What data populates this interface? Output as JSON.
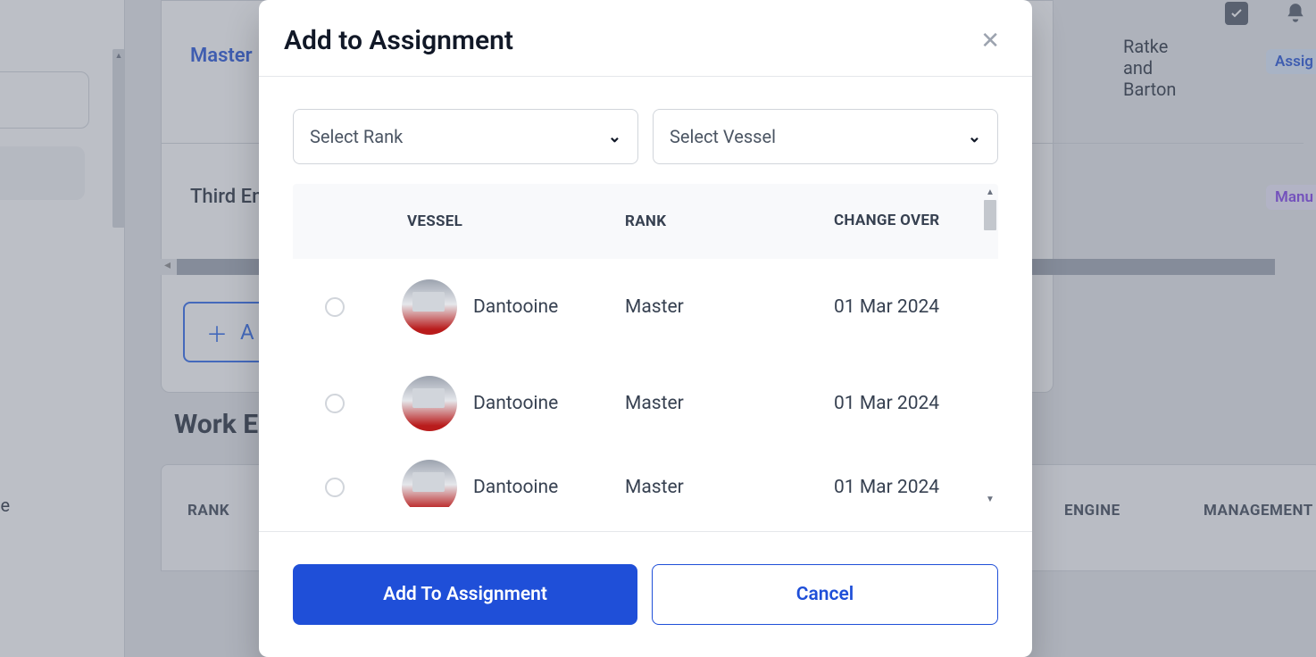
{
  "background": {
    "master_link": "Master",
    "third_en": "Third En",
    "add_btn": "A",
    "work_heading": "Work E",
    "left_text_ce": "ce",
    "ratke_text": "Ratke and Barton",
    "badge_assig": "Assig",
    "badge_manu": "Manu",
    "table": {
      "rank": "RANK",
      "engine": "ENGINE",
      "management": "MANAGEMENT"
    }
  },
  "modal": {
    "title": "Add to Assignment",
    "select_rank_placeholder": "Select Rank",
    "select_vessel_placeholder": "Select Vessel",
    "columns": {
      "vessel": "VESSEL",
      "rank": "RANK",
      "change_over": "CHANGE OVER"
    },
    "rows": [
      {
        "vessel": "Dantooine",
        "rank": "Master",
        "change_over": "01 Mar 2024"
      },
      {
        "vessel": "Dantooine",
        "rank": "Master",
        "change_over": "01 Mar 2024"
      },
      {
        "vessel": "Dantooine",
        "rank": "Master",
        "change_over": "01 Mar 2024"
      }
    ],
    "submit": "Add To Assignment",
    "cancel": "Cancel"
  }
}
